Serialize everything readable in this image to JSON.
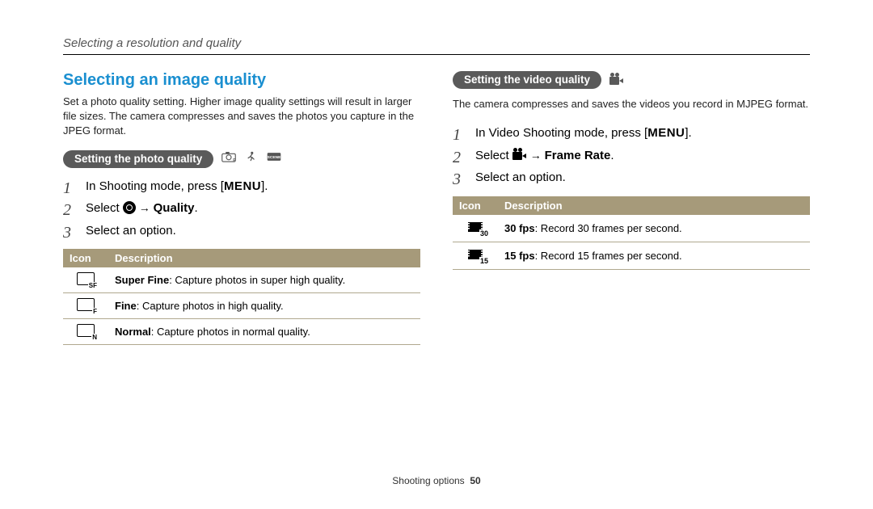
{
  "breadcrumb": "Selecting a resolution and quality",
  "left": {
    "title": "Selecting an image quality",
    "intro": "Set a photo quality setting. Higher image quality settings will result in larger file sizes. The camera compresses and saves the photos you capture in the JPEG format.",
    "subheading": "Setting the photo quality",
    "steps": {
      "s1_pre": "In Shooting mode, press [",
      "menu": "MENU",
      "s1_post": "].",
      "s2_pre": "Select ",
      "s2_arrow": " → ",
      "s2_bold": "Quality",
      "s2_post": ".",
      "s3": "Select an option."
    },
    "table": {
      "h1": "Icon",
      "h2": "Description",
      "rows": [
        {
          "sub": "SF",
          "bold": "Super Fine",
          "rest": ": Capture photos in super high quality."
        },
        {
          "sub": "F",
          "bold": "Fine",
          "rest": ": Capture photos in high quality."
        },
        {
          "sub": "N",
          "bold": "Normal",
          "rest": ": Capture photos in normal quality."
        }
      ]
    }
  },
  "right": {
    "subheading": "Setting the video quality",
    "intro": "The camera compresses and saves the videos you record in MJPEG format.",
    "steps": {
      "s1_pre": "In Video Shooting mode, press [",
      "menu": "MENU",
      "s1_post": "].",
      "s2_pre": "Select ",
      "s2_arrow": " → ",
      "s2_bold": "Frame Rate",
      "s2_post": ".",
      "s3": "Select an option."
    },
    "table": {
      "h1": "Icon",
      "h2": "Description",
      "rows": [
        {
          "sub": "30",
          "bold": "30 fps",
          "rest": ": Record 30 frames per second."
        },
        {
          "sub": "15",
          "bold": "15 fps",
          "rest": ": Record 15 frames per second."
        }
      ]
    }
  },
  "footer": {
    "section": "Shooting options",
    "page": "50"
  }
}
